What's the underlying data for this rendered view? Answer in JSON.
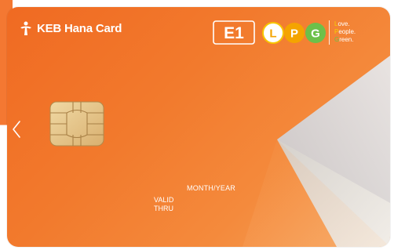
{
  "card": {
    "brand_name": "KEB Hana Card",
    "e1_text": "E1",
    "lpg_letters": [
      "L",
      "P",
      "G"
    ],
    "slogan": {
      "line1_first": "L",
      "line1_rest": "ove.",
      "line2_first": "P",
      "line2_rest": "eople.",
      "line3_first": "G",
      "line3_rest": "reen."
    },
    "month_year_label": "MONTH/YEAR",
    "valid_label": "VALID",
    "thru_label": "THRU"
  },
  "icons": {
    "logo": "hana-logo-icon",
    "chip": "chip-icon",
    "prev": "chevron-left-icon"
  },
  "colors": {
    "card_orange": "#f27a2d",
    "lpg_l": "#f7c600",
    "lpg_p": "#f4a400",
    "lpg_g": "#6cc04a",
    "chip_gold": "#e8c98a"
  }
}
